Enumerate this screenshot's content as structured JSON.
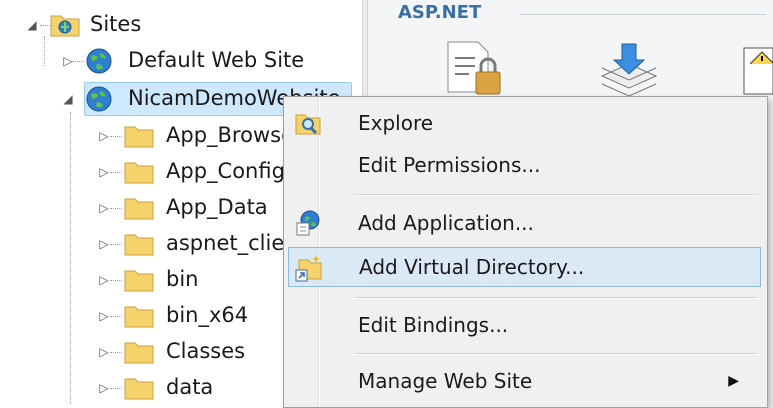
{
  "tree": {
    "root": {
      "label": "Sites",
      "expander": "◢"
    },
    "sites": [
      {
        "label": "Default Web Site",
        "expander": "▷"
      },
      {
        "label": "NicamDemoWebsite",
        "expander": "◢"
      }
    ],
    "folders": [
      {
        "label": "App_Browsers"
      },
      {
        "label": "App_Config"
      },
      {
        "label": "App_Data"
      },
      {
        "label": "aspnet_client"
      },
      {
        "label": "bin"
      },
      {
        "label": "bin_x64"
      },
      {
        "label": "Classes"
      },
      {
        "label": "data"
      }
    ]
  },
  "features": {
    "section_header": "ASP.NET",
    "icons": [
      "authorization-rules-icon",
      "publish-install-icon",
      "warning-icon"
    ]
  },
  "context_menu": {
    "items": [
      {
        "label": "Explore",
        "icon": "explore-icon"
      },
      {
        "label": "Edit Permissions...",
        "icon": ""
      },
      {
        "label": "Add Application...",
        "icon": "add-application-icon"
      },
      {
        "label": "Add Virtual Directory...",
        "icon": "add-virtual-directory-icon",
        "highlighted": true
      },
      {
        "label": "Edit Bindings...",
        "icon": ""
      },
      {
        "label": "Manage Web Site",
        "icon": "",
        "submenu_arrow": "▶"
      }
    ]
  },
  "colors": {
    "selection": "#cde8ff",
    "menu_highlight": "#dbe9f7",
    "header_blue": "#3a6fa6",
    "folder_yellow": "#f5d36c"
  }
}
